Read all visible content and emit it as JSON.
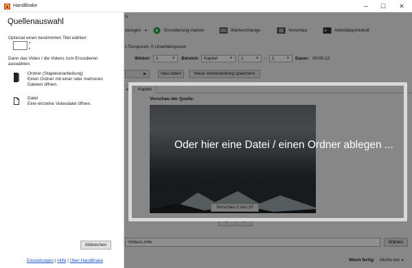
{
  "window": {
    "title": "HandBrake",
    "minimize_glyph": "─",
    "maximize_glyph": "☐",
    "close_glyph": "✕"
  },
  "background_app": {
    "menu_fragment": "ls",
    "toolbar": {
      "presets_label": "stungen",
      "start_label": "Encodierung starten",
      "queue_label": "Warteschlange",
      "preview_label": "Vorschau",
      "activity_label": "Aktivitätsprotokoll"
    },
    "source_info": "t-Tonspuren, 0 Untertitelspuren",
    "angle_label": "Winkel:",
    "angle_value": "1",
    "range_label": "Bereich:",
    "range_type": "Kapitel",
    "range_from": "1",
    "range_dash": "-",
    "range_to": "1",
    "duration_label": "Dauer:",
    "duration_value": "00:00:12",
    "reload_button": "Neu laden",
    "save_preset_button": "Neue Voreinstellung speichern",
    "tabs": [
      "er",
      "Kapitel"
    ],
    "preview_heading": "Vorschau der Quelle:",
    "preview_counter": "Vorschau 2 von 10",
    "prev_glyph": "<",
    "next_glyph": ">",
    "output_path_fragment": "\\Videos.m4v",
    "browse_button": "Wählen",
    "when_done_label": "Wenn fertig:",
    "when_done_value": "Nichts tun"
  },
  "dropzone": {
    "text": "Oder hier eine Datei / einen Ordner ablegen ..."
  },
  "source_panel": {
    "title": "Quellenauswahl",
    "title_prompt": "Optional einen bestimmten Titel wählen:",
    "title_value": "",
    "instruction": "Dann das Video / die Videos zum Encodieren auswählen:",
    "folder_title": "Ordner (Stapelverarbeitung)",
    "folder_desc": "Einen Ordner mit einer oder mehreren Dateien öffnen.",
    "file_title": "Datei",
    "file_desc": "Eine einzelne Videodatei öffnen.",
    "cancel_button": "Abbrechen",
    "links": {
      "settings": "Einstellungen",
      "sep1": "|",
      "help": "Hilfe",
      "sep2": "|",
      "about": "Über HandBrake"
    }
  },
  "colors": {
    "link": "#1a55c8",
    "overlay": "rgba(0,0,0,0.44)",
    "dropzone_border": "#d9d9d9",
    "start_icon": "#2ea043"
  }
}
